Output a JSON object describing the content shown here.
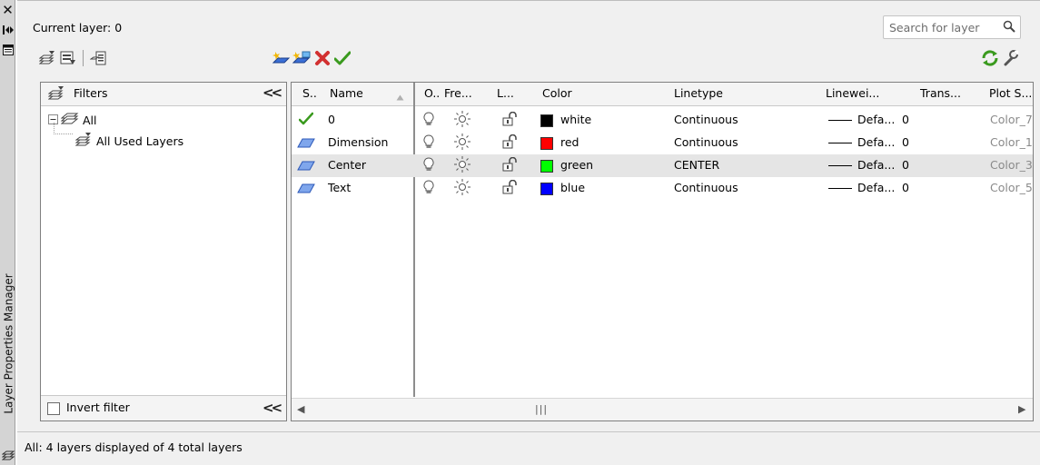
{
  "window": {
    "title": "Layer Properties Manager",
    "current_layer": "Current layer: 0"
  },
  "search": {
    "placeholder": "Search for layer"
  },
  "toolbar": {
    "left_icons": [
      "new-property-filter-icon",
      "new-group-filter-icon",
      "layer-states-manager-icon"
    ],
    "center_icons": [
      "new-layer-icon",
      "new-layer-vp-frozen-icon",
      "delete-layer-icon",
      "set-current-icon"
    ],
    "right_icons": [
      "refresh-icon",
      "settings-icon"
    ]
  },
  "filters": {
    "header": "Filters",
    "tree": [
      {
        "label": "All",
        "level": 0,
        "expanded": true
      },
      {
        "label": "All Used Layers",
        "level": 1
      }
    ],
    "invert_filter_label": "Invert filter",
    "invert_filter_checked": false
  },
  "grid": {
    "columns": [
      "S..",
      "Name",
      "O..",
      "Fre...",
      "L...",
      "Color",
      "Linetype",
      "Linewei...",
      "Trans...",
      "Plot S..."
    ],
    "sort_column": "Name",
    "rows": [
      {
        "status": "current",
        "name": "0",
        "on": true,
        "frozen": false,
        "locked": false,
        "color": "white",
        "color_hex": "#000000",
        "linetype": "Continuous",
        "lineweight": "Defa...",
        "transparency": "0",
        "plot_style": "Color_7",
        "selected": false
      },
      {
        "status": "layer",
        "name": "Dimension",
        "on": true,
        "frozen": false,
        "locked": false,
        "color": "red",
        "color_hex": "#ff0000",
        "linetype": "Continuous",
        "lineweight": "Defa...",
        "transparency": "0",
        "plot_style": "Color_1",
        "selected": false
      },
      {
        "status": "layer",
        "name": "Center",
        "on": true,
        "frozen": false,
        "locked": false,
        "color": "green",
        "color_hex": "#00ff00",
        "linetype": "CENTER",
        "lineweight": "Defa...",
        "transparency": "0",
        "plot_style": "Color_3",
        "selected": true
      },
      {
        "status": "layer",
        "name": "Text",
        "on": true,
        "frozen": false,
        "locked": false,
        "color": "blue",
        "color_hex": "#0000ff",
        "linetype": "Continuous",
        "lineweight": "Defa...",
        "transparency": "0",
        "plot_style": "Color_5",
        "selected": false
      }
    ]
  },
  "status_bar": {
    "text": "All: 4 layers displayed of 4 total layers"
  },
  "colors": {
    "accent_green": "#3a9a1e",
    "delete_red": "#d23030",
    "layer_icon_blue": "#3b6fd6"
  }
}
